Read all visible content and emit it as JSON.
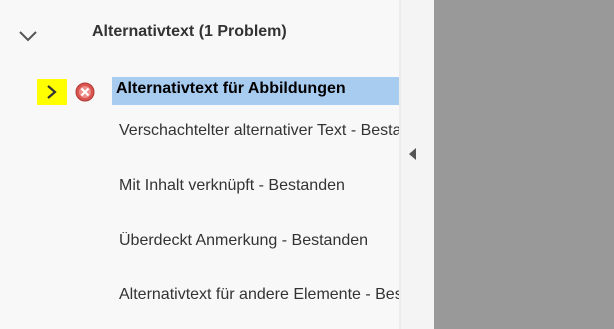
{
  "section": {
    "title": "Alternativtext (1 Problem)",
    "chevron_icon": "chevron-down-icon"
  },
  "selected_item": {
    "label": "Alternativtext für Abbildungen",
    "expand_icon": "chevron-right-icon",
    "status_icon": "error-icon"
  },
  "items": [
    {
      "label": "Verschachtelter alternativer Text - Bestanden"
    },
    {
      "label": "Mit Inhalt verknüpft - Bestanden"
    },
    {
      "label": "Überdeckt Anmerkung - Bestanden"
    },
    {
      "label": "Alternativtext für andere Elemente - Bestanden"
    }
  ],
  "colors": {
    "highlight": "#ffff00",
    "selection": "#a8cbf0",
    "error": "#d9534f",
    "document_area": "#999999"
  }
}
